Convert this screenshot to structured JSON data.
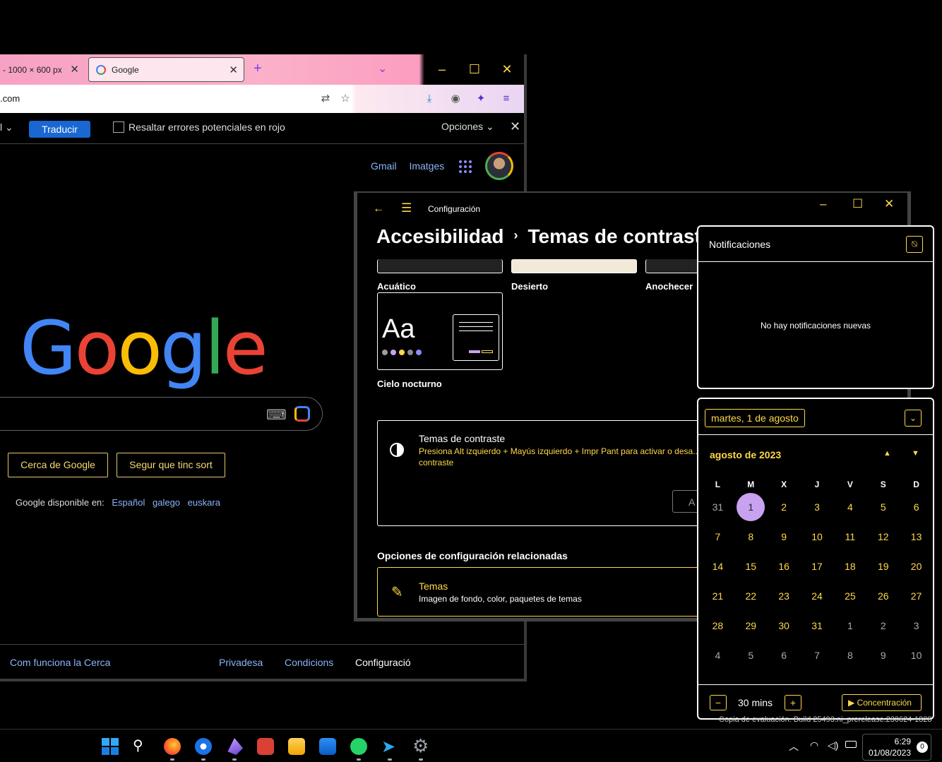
{
  "browser": {
    "tabs": [
      {
        "label": "- 1000 × 600 px"
      },
      {
        "label": "Google"
      }
    ],
    "url": ".com",
    "translate_bar": {
      "language": "l",
      "translate_button": "Traducir",
      "highlight_label": "Resaltar errores potenciales en rojo",
      "options_label": "Opciones",
      "options_caret": "⌄"
    },
    "header_links": {
      "gmail": "Gmail",
      "images": "Imatges"
    },
    "search_buttons": {
      "search": "Cerca de Google",
      "lucky": "Segur que tinc sort"
    },
    "available_in": {
      "label": "Google disponible en:",
      "languages": [
        "Español",
        "galego",
        "euskara"
      ]
    },
    "footer": {
      "how": "Com funciona la Cerca",
      "privacy": "Privadesa",
      "terms": "Condicions",
      "settings": "Configuració"
    }
  },
  "settings": {
    "app_title": "Configuración",
    "breadcrumb": {
      "parent": "Accesibilidad",
      "current": "Temas de contraste"
    },
    "themes": [
      {
        "name": "Acuático"
      },
      {
        "name": "Desierto"
      },
      {
        "name": "Anochecer"
      },
      {
        "name": "Cielo nocturno"
      }
    ],
    "night_preview_text": "Aa",
    "night_dot_colors": [
      "#9aa0a6",
      "#c8a2f0",
      "#ffd84a",
      "#8a8a8a",
      "#8a8cf8"
    ],
    "contrast_card": {
      "title": "Temas de contraste",
      "description": "Presiona Alt izquierdo + Mayús izquierdo + Impr Pant para activar o desa... de contraste",
      "apply_button": "A"
    },
    "related_heading": "Opciones de configuración relacionadas",
    "themes_link": {
      "title": "Temas",
      "description": "Imagen de fondo, color, paquetes de temas"
    }
  },
  "notifications": {
    "title": "Notificaciones",
    "empty_text": "No hay notificaciones nuevas"
  },
  "calendar": {
    "selected_date": "martes, 1 de agosto",
    "month_label": "agosto de 2023",
    "weekday_headers": [
      "L",
      "M",
      "X",
      "J",
      "V",
      "S",
      "D"
    ],
    "weeks": [
      [
        "31",
        "1",
        "2",
        "3",
        "4",
        "5",
        "6"
      ],
      [
        "7",
        "8",
        "9",
        "10",
        "11",
        "12",
        "13"
      ],
      [
        "14",
        "15",
        "16",
        "17",
        "18",
        "19",
        "20"
      ],
      [
        "21",
        "22",
        "23",
        "24",
        "25",
        "26",
        "27"
      ],
      [
        "28",
        "29",
        "30",
        "31",
        "1",
        "2",
        "3"
      ],
      [
        "4",
        "5",
        "6",
        "7",
        "8",
        "9",
        "10"
      ]
    ],
    "today": "1",
    "focus": {
      "duration": "30 mins",
      "button": "Concentración"
    },
    "accent_color": "#ffd84a",
    "today_color": "#c8a2f0"
  },
  "watermark": "Copia de evaluación. Build 25493.ni_prerelease.230624-1828",
  "taskbar": {
    "apps": [
      "windows-start",
      "search",
      "firefox",
      "thunderbird",
      "obsidian",
      "todoist",
      "file-explorer",
      "microsoft-store",
      "whatsapp",
      "telegram",
      "settings"
    ],
    "clock_time": "6:29",
    "clock_date": "01/08/2023",
    "notification_count": "0"
  }
}
